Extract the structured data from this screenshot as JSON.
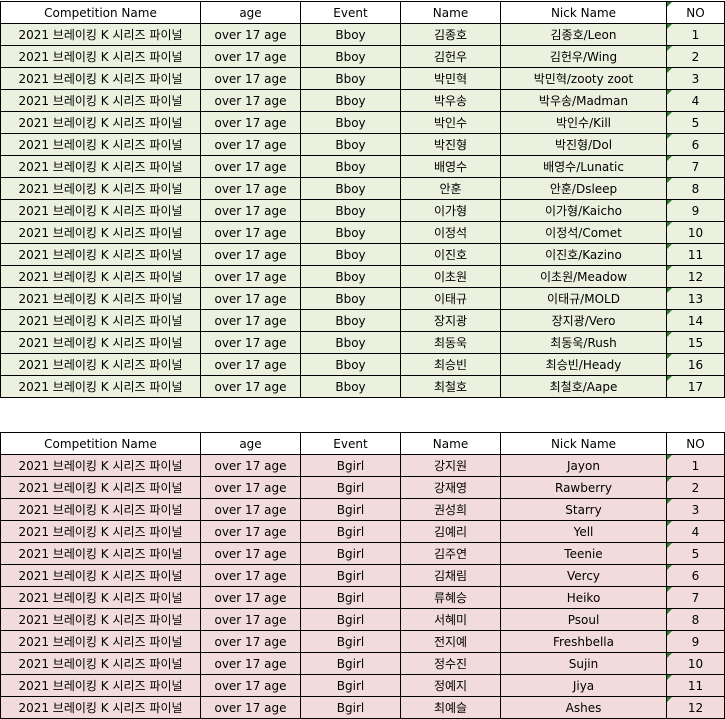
{
  "headers": [
    "Competition Name",
    "age",
    "Event",
    "Name",
    "Nick Name",
    "NO"
  ],
  "colors": {
    "bboy_row_bg": "#ebf1de",
    "bgirl_row_bg": "#f2dcdb",
    "note_marker": "#2e7d32"
  },
  "bboy_rows": [
    [
      "2021 브레이킹 K 시리즈 파이널",
      "over 17 age",
      "Bboy",
      "김종호",
      "김종호/Leon",
      "1"
    ],
    [
      "2021 브레이킹 K 시리즈 파이널",
      "over 17 age",
      "Bboy",
      "김헌우",
      "김헌우/Wing",
      "2"
    ],
    [
      "2021 브레이킹 K 시리즈 파이널",
      "over 17 age",
      "Bboy",
      "박민혁",
      "박민혁/zooty zoot",
      "3"
    ],
    [
      "2021 브레이킹 K 시리즈 파이널",
      "over 17 age",
      "Bboy",
      "박우송",
      "박우송/Madman",
      "4"
    ],
    [
      "2021 브레이킹 K 시리즈 파이널",
      "over 17 age",
      "Bboy",
      "박인수",
      "박인수/Kill",
      "5"
    ],
    [
      "2021 브레이킹 K 시리즈 파이널",
      "over 17 age",
      "Bboy",
      "박진형",
      "박진형/Dol",
      "6"
    ],
    [
      "2021 브레이킹 K 시리즈 파이널",
      "over 17 age",
      "Bboy",
      "배영수",
      "배영수/Lunatic",
      "7"
    ],
    [
      "2021 브레이킹 K 시리즈 파이널",
      "over 17 age",
      "Bboy",
      "안훈",
      "안훈/Dsleep",
      "8"
    ],
    [
      "2021 브레이킹 K 시리즈 파이널",
      "over 17 age",
      "Bboy",
      "이가형",
      "이가형/Kaicho",
      "9"
    ],
    [
      "2021 브레이킹 K 시리즈 파이널",
      "over 17 age",
      "Bboy",
      "이정석",
      "이정석/Comet",
      "10"
    ],
    [
      "2021 브레이킹 K 시리즈 파이널",
      "over 17 age",
      "Bboy",
      "이진호",
      "이진호/Kazino",
      "11"
    ],
    [
      "2021 브레이킹 K 시리즈 파이널",
      "over 17 age",
      "Bboy",
      "이초원",
      "이초원/Meadow",
      "12"
    ],
    [
      "2021 브레이킹 K 시리즈 파이널",
      "over 17 age",
      "Bboy",
      "이태규",
      "이태규/MOLD",
      "13"
    ],
    [
      "2021 브레이킹 K 시리즈 파이널",
      "over 17 age",
      "Bboy",
      "장지광",
      "장지광/Vero",
      "14"
    ],
    [
      "2021 브레이킹 K 시리즈 파이널",
      "over 17 age",
      "Bboy",
      "최동욱",
      "최동욱/Rush",
      "15"
    ],
    [
      "2021 브레이킹 K 시리즈 파이널",
      "over 17 age",
      "Bboy",
      "최승빈",
      "최승빈/Heady",
      "16"
    ],
    [
      "2021 브레이킹 K 시리즈 파이널",
      "over 17 age",
      "Bboy",
      "최철호",
      "최철호/Aape",
      "17"
    ]
  ],
  "bgirl_rows": [
    [
      "2021 브레이킹 K 시리즈 파이널",
      "over 17 age",
      "Bgirl",
      "강지원",
      "Jayon",
      "1"
    ],
    [
      "2021 브레이킹 K 시리즈 파이널",
      "over 17 age",
      "Bgirl",
      "강재영",
      "Rawberry",
      "2"
    ],
    [
      "2021 브레이킹 K 시리즈 파이널",
      "over 17 age",
      "Bgirl",
      "권성희",
      "Starry",
      "3"
    ],
    [
      "2021 브레이킹 K 시리즈 파이널",
      "over 17 age",
      "Bgirl",
      "김예리",
      "Yell",
      "4"
    ],
    [
      "2021 브레이킹 K 시리즈 파이널",
      "over 17 age",
      "Bgirl",
      "김주연",
      "Teenie",
      "5"
    ],
    [
      "2021 브레이킹 K 시리즈 파이널",
      "over 17 age",
      "Bgirl",
      "김채림",
      "Vercy",
      "6"
    ],
    [
      "2021 브레이킹 K 시리즈 파이널",
      "over 17 age",
      "Bgirl",
      "류혜승",
      "Heiko",
      "7"
    ],
    [
      "2021 브레이킹 K 시리즈 파이널",
      "over 17 age",
      "Bgirl",
      "서혜미",
      "Psoul",
      "8"
    ],
    [
      "2021 브레이킹 K 시리즈 파이널",
      "over 17 age",
      "Bgirl",
      "전지예",
      "Freshbella",
      "9"
    ],
    [
      "2021 브레이킹 K 시리즈 파이널",
      "over 17 age",
      "Bgirl",
      "정수진",
      "Sujin",
      "10"
    ],
    [
      "2021 브레이킹 K 시리즈 파이널",
      "over 17 age",
      "Bgirl",
      "정예지",
      "Jiya",
      "11"
    ],
    [
      "2021 브레이킹 K 시리즈 파이널",
      "over 17 age",
      "Bgirl",
      "최예슬",
      "Ashes",
      "12"
    ]
  ]
}
